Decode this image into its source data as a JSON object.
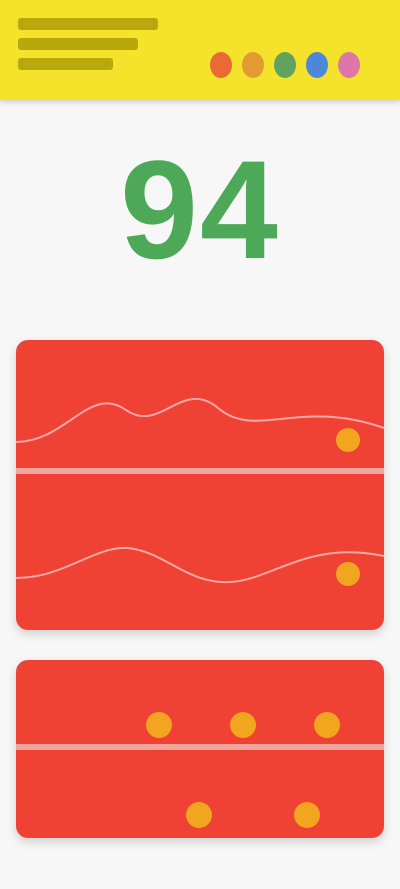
{
  "header": {
    "logo_lines": [
      "",
      "",
      ""
    ],
    "dots": [
      {
        "name": "red-dot-icon",
        "color": "#e96a35"
      },
      {
        "name": "orange-dot-icon",
        "color": "#e49a33"
      },
      {
        "name": "green-dot-icon",
        "color": "#5fa35e"
      },
      {
        "name": "blue-dot-icon",
        "color": "#4d87d9"
      },
      {
        "name": "pink-dot-icon",
        "color": "#dd77a9"
      }
    ]
  },
  "score": {
    "value": "94"
  },
  "subtitle": "",
  "top_card": {
    "rows": [
      {
        "title": "",
        "left_label": "",
        "right_label": ""
      },
      {
        "title": "",
        "left_label": "",
        "right_label": ""
      }
    ]
  },
  "bottom_card": {
    "rows": [
      {
        "label": "",
        "slot_count": 3
      },
      {
        "label": "",
        "slot_count": 2
      }
    ]
  },
  "bottom_nav": [
    "",
    "",
    ""
  ],
  "colors": {
    "header": "#f4e32a",
    "score": "#4da857",
    "card": "#ef4134",
    "accent": "#f2a61f"
  }
}
